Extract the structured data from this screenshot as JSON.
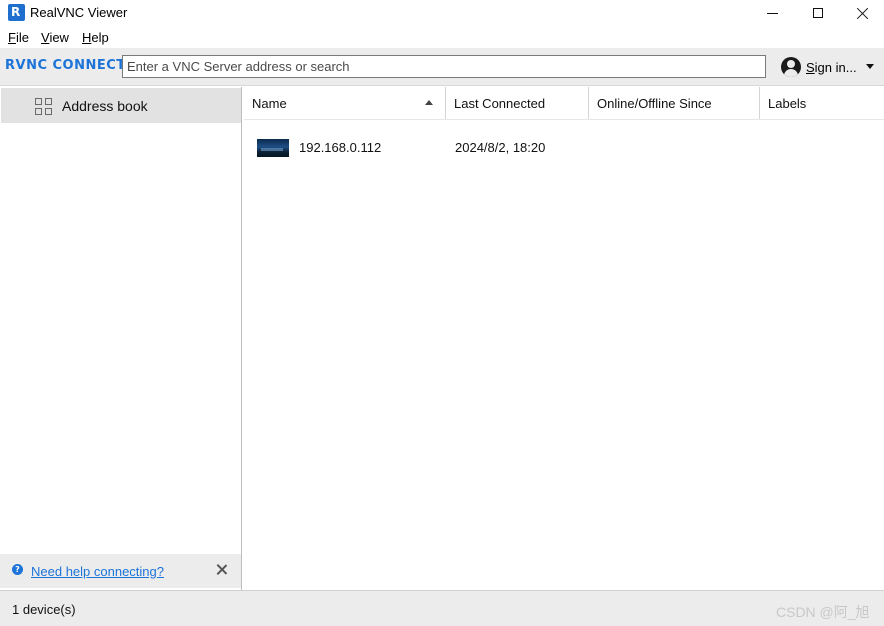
{
  "window": {
    "title": "RealVNC Viewer",
    "app_icon": "realvnc-logo-icon",
    "controls": [
      "minimize",
      "maximize",
      "close"
    ]
  },
  "menu": {
    "file": {
      "label": "File",
      "mnemonic": "F",
      "rest": "ile"
    },
    "view": {
      "label": "View",
      "mnemonic": "V",
      "rest": "iew"
    },
    "help": {
      "label": "Help",
      "mnemonic": "H",
      "rest": "elp"
    }
  },
  "toolbar": {
    "brand": "RVNC CONNECT",
    "search_placeholder": "Enter a VNC Server address or search",
    "signin": {
      "label": "Sign in...",
      "mnemonic": "S",
      "rest": "ign in..."
    },
    "brand_color": "#1c73d8"
  },
  "sidebar": {
    "items": [
      {
        "label": "Address book",
        "icon": "grid-icon",
        "selected": true
      }
    ],
    "help_link": "Need help connecting?"
  },
  "table": {
    "columns": [
      "Name",
      "Last Connected",
      "Online/Offline Since",
      "Labels"
    ],
    "sort_column": "Name",
    "sort_direction": "ascending",
    "rows": [
      {
        "name": "192.168.0.112",
        "last_connected": "2024/8/2, 18:20",
        "online_since": "",
        "labels": ""
      }
    ]
  },
  "status": {
    "device_count": "1 device(s)"
  },
  "watermark": "CSDN @阿_旭"
}
